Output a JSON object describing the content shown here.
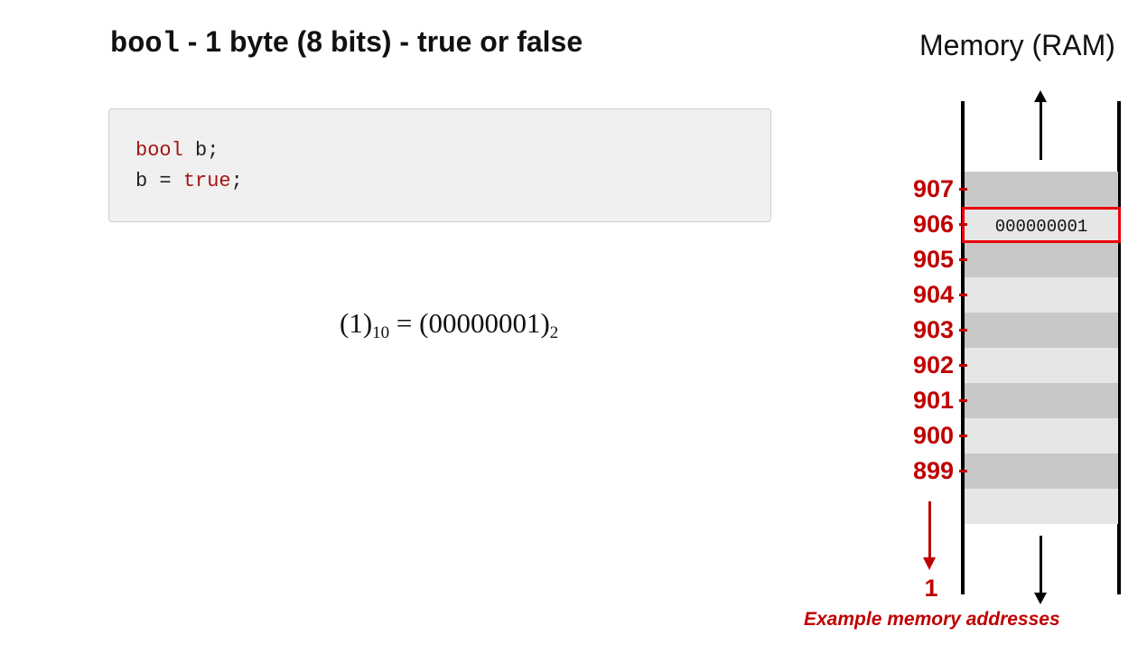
{
  "title": {
    "type_name": "bool",
    "rest": " - 1 byte (8 bits)  - true or false"
  },
  "code": {
    "line1": {
      "keyword": "bool",
      "rest": " b;"
    },
    "line2": {
      "prefix": "b = ",
      "keyword": "true",
      "suffix": ";"
    }
  },
  "equation": {
    "left": "(1)",
    "left_base": "10",
    "equals": " = ",
    "right": "(00000001)",
    "right_base": "2"
  },
  "memory": {
    "title": "Memory (RAM)",
    "highlighted_value": "000000001",
    "addresses": [
      "907",
      "906",
      "905",
      "904",
      "903",
      "902",
      "901",
      "900",
      "899"
    ],
    "bottom_address": "1",
    "caption": "Example memory addresses"
  },
  "colors": {
    "accent_red": "#c00000",
    "highlight_border": "#e8000b",
    "code_keyword": "#a31515",
    "cell_dark": "#c8c8c8",
    "cell_light": "#e6e6e6"
  }
}
